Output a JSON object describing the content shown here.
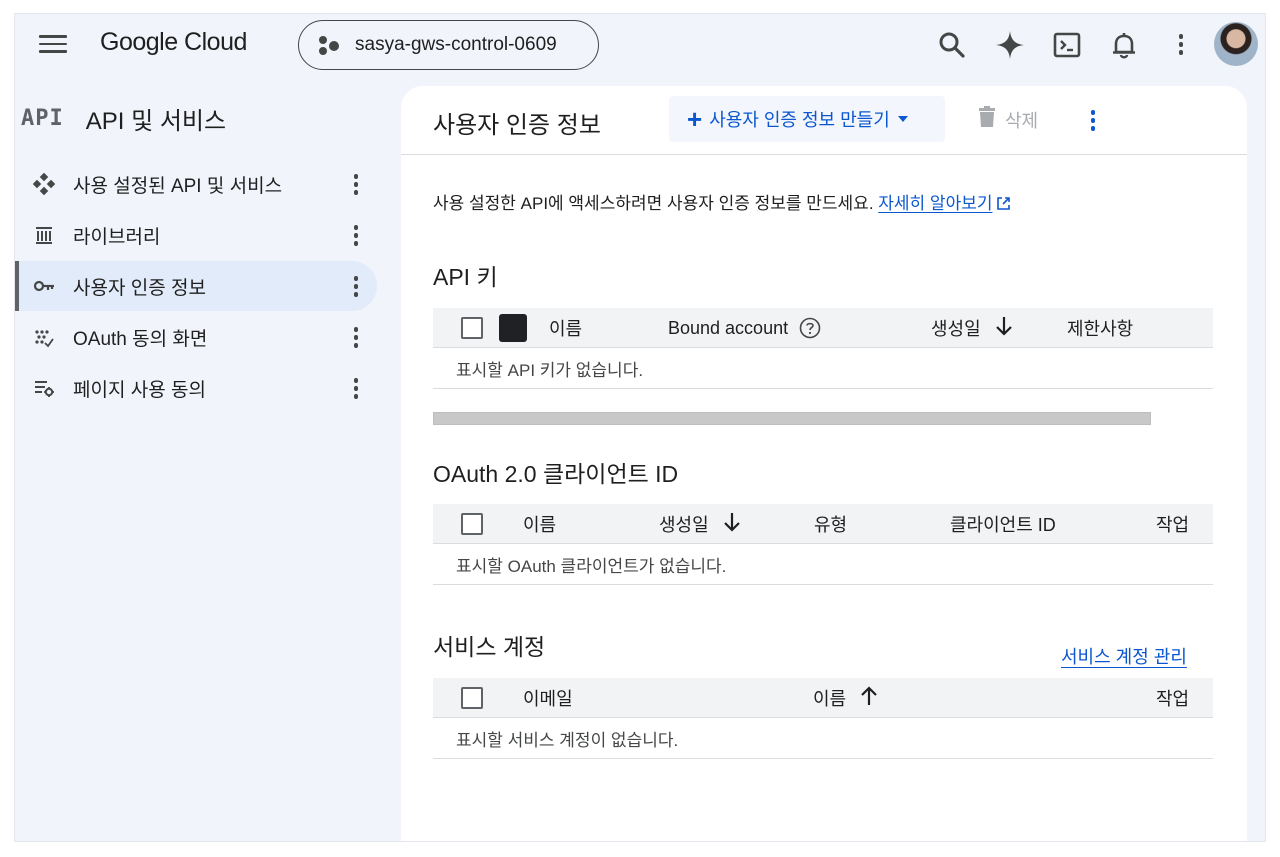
{
  "header": {
    "logo": "Google Cloud",
    "project": "sasya-gws-control-0609",
    "icons": [
      "search-icon",
      "gemini-sparkle-icon",
      "cloud-shell-icon",
      "notifications-bell-icon",
      "more-vert-icon",
      "avatar"
    ]
  },
  "sidebar": {
    "badge": "API",
    "title": "API 및 서비스",
    "items": [
      {
        "label": "사용 설정된 API 및 서비스",
        "icon": "enabled-apis-icon",
        "active": false
      },
      {
        "label": "라이브러리",
        "icon": "library-icon",
        "active": false
      },
      {
        "label": "사용자 인증 정보",
        "icon": "key-icon",
        "active": true
      },
      {
        "label": "OAuth 동의 화면",
        "icon": "oauth-consent-icon",
        "active": false
      },
      {
        "label": "페이지 사용 동의",
        "icon": "page-usage-icon",
        "active": false
      }
    ]
  },
  "main": {
    "title": "사용자 인증 정보",
    "create_label": "사용자 인증 정보 만들기",
    "delete_label": "삭제",
    "intro_text": "사용 설정한 API에 액세스하려면 사용자 인증 정보를 만드세요.",
    "learn_more": "자세히 알아보기",
    "api_keys": {
      "title": "API 키",
      "columns": [
        "이름",
        "Bound account",
        "생성일",
        "제한사항"
      ],
      "empty": "표시할 API 키가 없습니다."
    },
    "oauth": {
      "title": "OAuth 2.0 클라이언트 ID",
      "columns": [
        "이름",
        "생성일",
        "유형",
        "클라이언트 ID",
        "작업"
      ],
      "empty": "표시할 OAuth 클라이언트가 없습니다."
    },
    "service_accounts": {
      "title": "서비스 계정",
      "manage_label": "서비스 계정 관리",
      "columns": [
        "이메일",
        "이름",
        "작업"
      ],
      "empty": "표시할 서비스 계정이 없습니다."
    }
  },
  "colors": {
    "accent": "#0b57d0",
    "page_bg": "#f1f4fb",
    "active_nav_bg": "#e2ebf9",
    "table_header_bg": "#f1f3f4"
  }
}
